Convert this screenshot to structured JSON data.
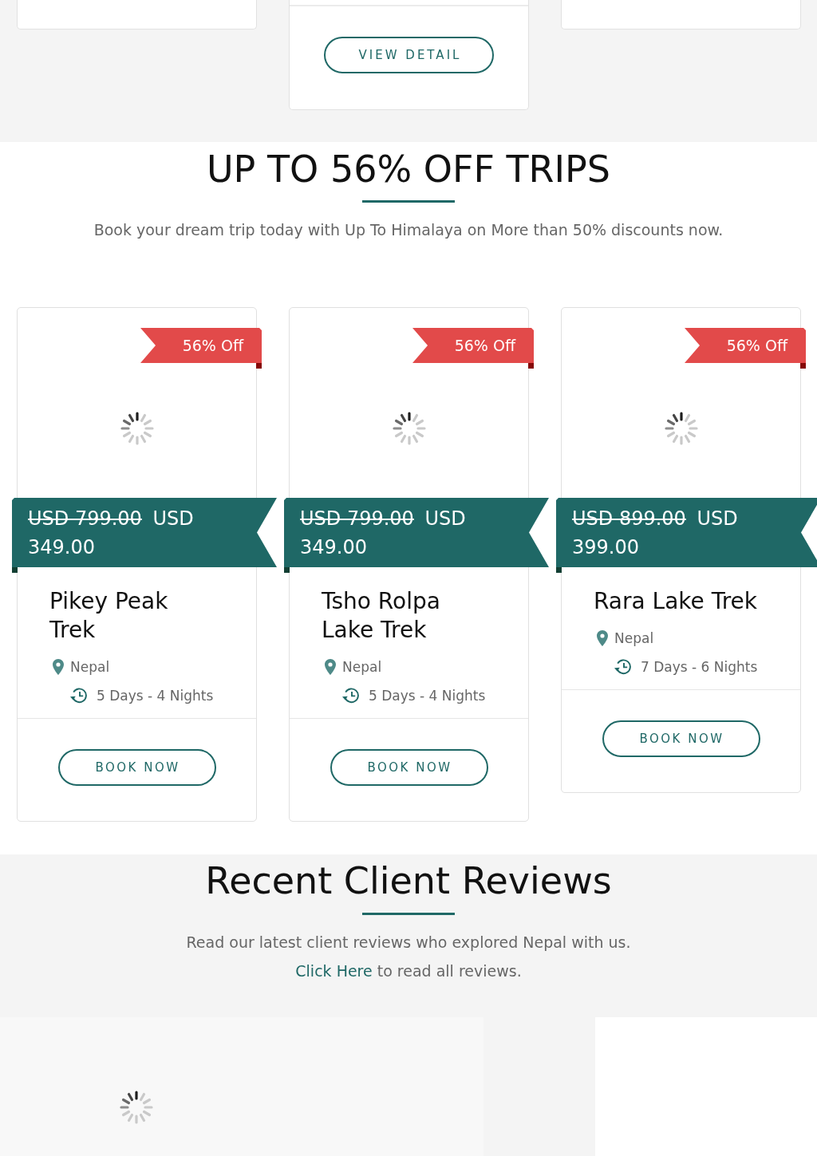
{
  "previous_section": {
    "cards": [
      {
        "kind": "plain"
      },
      {
        "kind": "detail",
        "button": "VIEW DETAIL"
      },
      {
        "kind": "plain"
      }
    ]
  },
  "deals": {
    "title": "UP TO 56% OFF TRIPS",
    "subtitle": "Book your dream trip today with Up To Himalaya on More than 50% discounts now.",
    "trips": [
      {
        "discount": "56% Off",
        "old_price": "USD 799.00",
        "price": "USD 349.00",
        "name": "Pikey Peak Trek",
        "location": "Nepal",
        "duration": "5 Days - 4 Nights",
        "button": "BOOK NOW"
      },
      {
        "discount": "56% Off",
        "old_price": "USD 799.00",
        "price": "USD 349.00",
        "name": "Tsho Rolpa Lake Trek",
        "location": "Nepal",
        "duration": "5 Days - 4 Nights",
        "button": "BOOK NOW"
      },
      {
        "discount": "56% Off",
        "old_price": "USD 899.00",
        "price": "USD 399.00",
        "name": "Rara Lake Trek",
        "location": "Nepal",
        "duration": "7 Days - 6 Nights",
        "button": "BOOK NOW"
      }
    ]
  },
  "reviews": {
    "title": "Recent Client Reviews",
    "intro": "Read our latest client reviews who explored Nepal with us.",
    "link": "Click Here",
    "note": "to read all reviews.",
    "panels": [
      {
        "kind": "loading"
      },
      {
        "kind": "blank"
      }
    ]
  }
}
